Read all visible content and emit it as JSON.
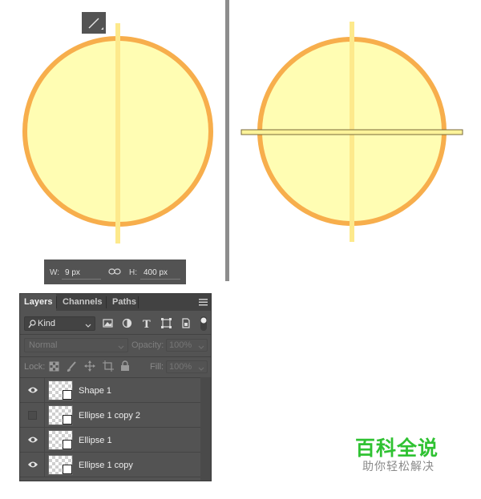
{
  "canvas": {
    "circle_fill": "#fffdb3",
    "circle_stroke": "#f7ae4c",
    "line_color": "#fde98c",
    "horizontal_bar_fill": "#fbf39a",
    "horizontal_bar_stroke": "#7a6a3a",
    "divider_color": "#8d8d8d",
    "tool_icon": "line-tool-icon"
  },
  "dimensions_bar": {
    "width_label": "W:",
    "width_value": "9 px",
    "link_icon": "link-icon",
    "height_label": "H:",
    "height_value": "400 px"
  },
  "layers_panel": {
    "tabs": [
      {
        "label": "Layers",
        "active": true
      },
      {
        "label": "Channels",
        "active": false
      },
      {
        "label": "Paths",
        "active": false
      }
    ],
    "menu_icon": "panel-menu-icon",
    "filter": {
      "search_icon": "search-icon",
      "kind_label": "Kind",
      "filter_icons": [
        "image-filter-icon",
        "adjustment-filter-icon",
        "type-filter-icon",
        "shape-filter-icon",
        "smart-object-filter-icon",
        "filter-toggle-icon"
      ]
    },
    "blend_mode": "Normal",
    "opacity_label": "Opacity:",
    "opacity_value": "100%",
    "lock_label": "Lock:",
    "lock_icons": [
      "lock-transparent-icon",
      "lock-image-icon",
      "lock-position-icon",
      "lock-artboard-icon",
      "lock-all-icon"
    ],
    "fill_label": "Fill:",
    "fill_value": "100%",
    "layers": [
      {
        "name": "Shape 1",
        "visible": true
      },
      {
        "name": "Ellipse 1 copy 2",
        "visible": false
      },
      {
        "name": "Ellipse 1",
        "visible": true
      },
      {
        "name": "Ellipse 1 copy",
        "visible": true
      }
    ]
  },
  "watermark": {
    "title": "百科全说",
    "subtitle": "助你轻松解决",
    "title_color": "#2fc232"
  }
}
